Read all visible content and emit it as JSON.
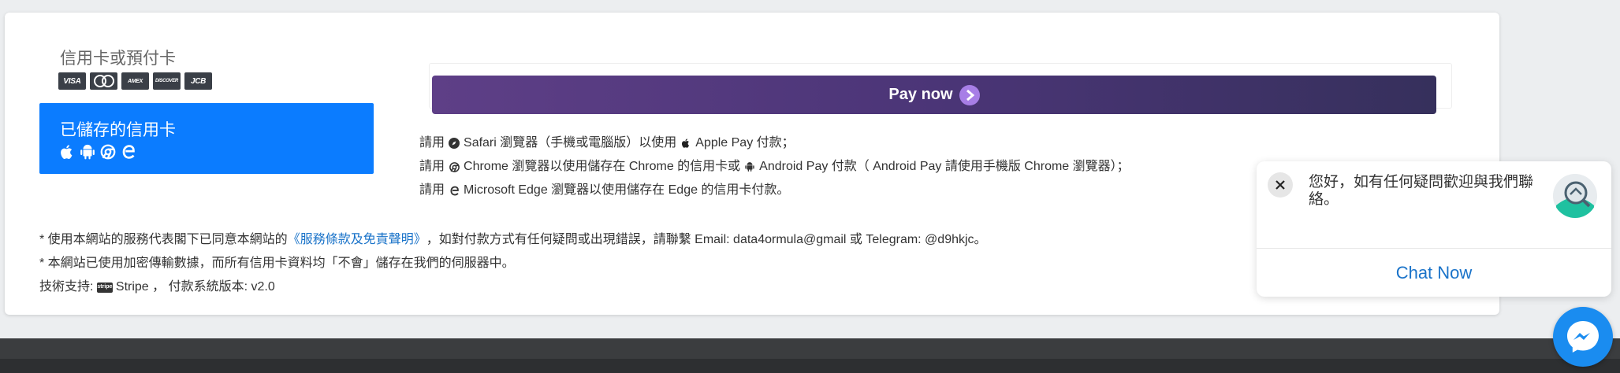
{
  "payment": {
    "cc_title": "信用卡或預付卡",
    "brands": [
      "VISA",
      "MC",
      "AMEX",
      "DISCOVER",
      "JCB"
    ],
    "saved_card_title": "已儲存的信用卡",
    "pay_button_label": "Pay now"
  },
  "notes": {
    "line1_a": "請用",
    "line1_b": "Safari 瀏覽器（手機或電腦版）以使用",
    "line1_c": "Apple Pay 付款；",
    "line2_a": "請用",
    "line2_b": "Chrome 瀏覽器以使用儲存在 Chrome 的信用卡或",
    "line2_c": "Android Pay 付款（ Android Pay 請使用手機版 Chrome 瀏覽器）；",
    "line3_a": "請用",
    "line3_b": "Microsoft Edge 瀏覽器以使用儲存在 Edge 的信用卡付款。"
  },
  "footer": {
    "line1_a": "* 使用本網站的服務代表閣下已同意本網站的",
    "terms_link": "《服務條款及免責聲明》",
    "line1_b": "，如對付款方式有任何疑問或出現錯誤，請聯繫 Email: data4ormula@gmail 或 Telegram: @d9hkjc。",
    "line2": "* 本網站已使用加密傳輸數據，而所有信用卡資料均「不會」儲存在我們的伺服器中。",
    "line3_a": "技術支持:",
    "stripe_badge": "stripe",
    "line3_b": "Stripe ， 付款系統版本: v2.0"
  },
  "chat": {
    "message": "您好，如有任何疑問歡迎與我們聯絡。",
    "chat_now_label": "Chat Now"
  },
  "colors": {
    "saved_card_bg": "#0b7cff",
    "pay_button_start": "#5e3f87",
    "pay_button_end": "#36305c",
    "link": "#1a73c9",
    "messenger": "#1a8cf0"
  }
}
